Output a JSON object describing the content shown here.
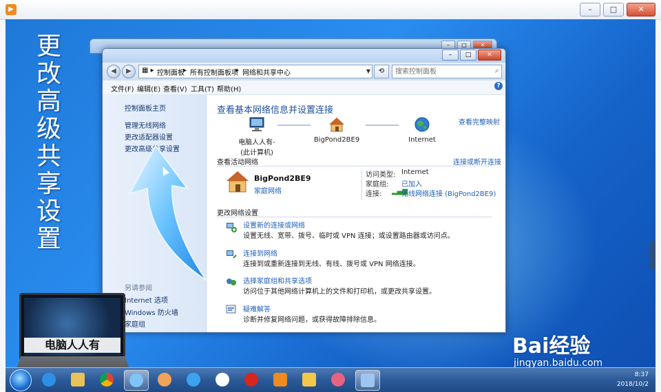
{
  "overlay": {
    "vertical_title": "更改高级共享设置",
    "laptop_label": "电脑人人有",
    "watermark": {
      "brand": "Bai经验",
      "site": "jingyan.baidu.com"
    }
  },
  "explorer": {
    "breadcrumbs": [
      "控制面板",
      "所有控制面板项",
      "网络和共享中心"
    ],
    "search_placeholder": "搜索控制面板",
    "menu": [
      "文件(F)",
      "编辑(E)",
      "查看(V)",
      "工具(T)",
      "帮助(H)"
    ]
  },
  "sidebar": {
    "links": [
      "控制面板主页",
      "管理无线网络",
      "更改适配器设置",
      "更改高级共享设置"
    ],
    "see_also_label": "另请参阅",
    "see_also": [
      "Internet 选项",
      "Windows 防火墙",
      "家庭组"
    ]
  },
  "main": {
    "title": "查看基本网络信息并设置连接",
    "full_map_link": "查看完整映射",
    "nodes": [
      {
        "name": "电脑人人有-",
        "sub": "(此计算机)"
      },
      {
        "name": "BigPond2BE9",
        "sub": ""
      },
      {
        "name": "Internet",
        "sub": ""
      }
    ],
    "active_networks_title": "查看活动网络",
    "connect_disconnect_link": "连接或断开连接",
    "active_network": {
      "name": "BigPond2BE9",
      "type": "家庭网络",
      "access_type_label": "访问类型:",
      "access_type": "Internet",
      "homegroup_label": "家庭组:",
      "homegroup": "已加入",
      "connection_label": "连接:",
      "connection": "无线网络连接 (BigPond2BE9)"
    },
    "change_settings_title": "更改网络设置",
    "tasks": [
      {
        "title": "设置新的连接或网络",
        "desc": "设置无线、宽带、拨号、临时或 VPN 连接；或设置路由器或访问点。"
      },
      {
        "title": "连接到网络",
        "desc": "连接到或重新连接到无线、有线、拨号或 VPN 网络连接。"
      },
      {
        "title": "选择家庭组和共享选项",
        "desc": "访问位于其他网络计算机上的文件和打印机，或更改共享设置。"
      },
      {
        "title": "疑难解答",
        "desc": "诊断并修复网络问题，或获得故障排除信息。"
      }
    ]
  },
  "taskbar": {
    "time": "8:37",
    "date": "2018/10/2",
    "items": [
      "ie-icon",
      "explorer-icon",
      "chrome-icon",
      "network-app-icon",
      "paint-icon",
      "cloud-icon",
      "pinwheel-icon",
      "chess-icon",
      "video-player-icon",
      "folder-icon",
      "game-icon",
      "network-center-icon"
    ]
  },
  "colors": {
    "link": "#1e5fb8",
    "title": "#1e4f9c",
    "desktop": "#1e78d8"
  }
}
